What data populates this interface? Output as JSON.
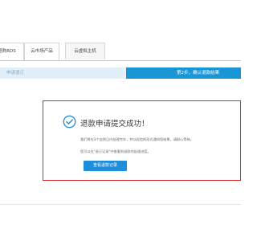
{
  "tabs": [
    {
      "label": "退购RDS"
    },
    {
      "label": "云市场产品"
    },
    {
      "label": "云虚拟主机"
    }
  ],
  "progress": {
    "step_left": "申请退订",
    "step_right": "第2步，确认退款结果"
  },
  "result": {
    "title": "退款申请提交成功！",
    "desc_line1": "我们将在3个自然日内处理完毕，并以短信的形式通知您结果，请耐心等待。",
    "desc_line2": "您可以在\"退订记录\"中查看到退款的处理进度。",
    "button_label": "查看退款记录"
  },
  "colors": {
    "accent_blue": "#1a96d6",
    "button_blue": "#1f8ed8",
    "border_red": "#d9282a",
    "check_blue": "#2a8fd6"
  }
}
